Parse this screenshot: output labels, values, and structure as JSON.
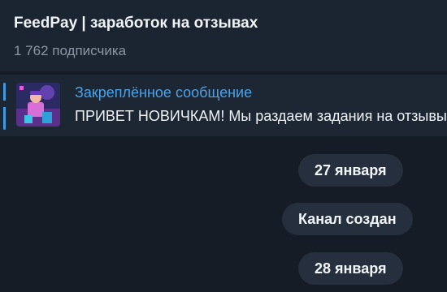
{
  "header": {
    "title": "FeedPay | заработок на отзывах",
    "subscribers": "1 762 подписчика"
  },
  "pinned": {
    "label": "Закреплённое сообщение",
    "text": "ПРИВЕТ НОВИЧКАМ!  Мы раздаем задания на отзывы",
    "thumbnail_icon": "channel-avatar-image"
  },
  "messages": [
    {
      "type": "date",
      "text": "27 января"
    },
    {
      "type": "service",
      "text": "Канал создан"
    },
    {
      "type": "date",
      "text": "28 января"
    }
  ],
  "colors": {
    "accent": "#4ea1e6",
    "background": "#151c26",
    "header": "#1b2431",
    "pill": "#252f3d"
  }
}
